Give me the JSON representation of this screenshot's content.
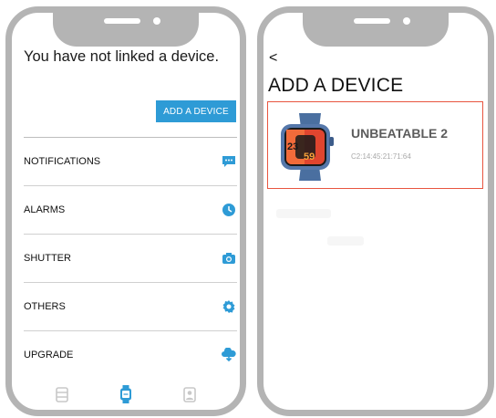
{
  "left_phone": {
    "message": "You have not linked a device.",
    "add_device_button": "ADD A DEVICE",
    "menu": [
      {
        "label": "NOTIFICATIONS",
        "icon": "chat-bubble-icon"
      },
      {
        "label": "ALARMS",
        "icon": "clock-icon"
      },
      {
        "label": "SHUTTER",
        "icon": "camera-icon"
      },
      {
        "label": "OTHERS",
        "icon": "gear-icon"
      },
      {
        "label": "UPGRADE",
        "icon": "cloud-download-icon"
      }
    ],
    "bottom_nav": [
      {
        "icon": "device-card-icon",
        "active": false
      },
      {
        "icon": "watch-icon",
        "active": true
      },
      {
        "icon": "profile-icon",
        "active": false
      }
    ]
  },
  "right_phone": {
    "back_symbol": "<",
    "title": "ADD A DEVICE",
    "device": {
      "name": "UNBEATABLE 2",
      "mac": "C2:14:45:21:71:64",
      "watch_time_hours": "23",
      "watch_time_minutes": "59"
    }
  },
  "colors": {
    "accent_blue": "#2e9bd6",
    "frame_gray": "#b4b4b4",
    "highlight_border": "#e8553f",
    "watch_strap": "#4a6fa0"
  }
}
